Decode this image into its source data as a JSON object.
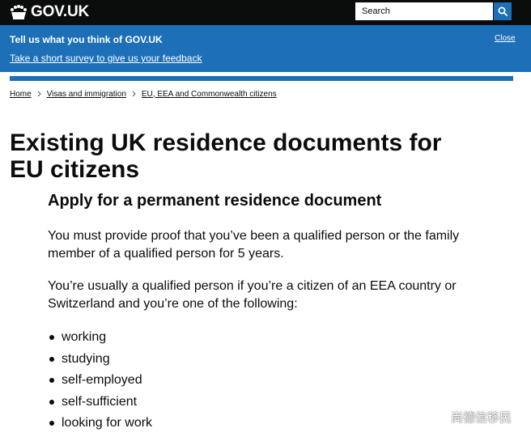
{
  "colors": {
    "header_bg": "#0b0c0c",
    "brand_blue": "#1d70b8",
    "text": "#0b0c0c",
    "white": "#ffffff"
  },
  "header": {
    "logo_text": "GOV.UK",
    "logo_icon": "crown-icon",
    "search_placeholder": "Search",
    "search_icon": "search-icon"
  },
  "survey_banner": {
    "title": "Tell us what you think of GOV.UK",
    "link": "Take a short survey to give us your feedback",
    "close": "Close"
  },
  "breadcrumb": {
    "items": [
      "Home",
      "Visas and immigration",
      "EU, EEA and Commonwealth citizens"
    ],
    "separator_icon": "chevron-right-icon"
  },
  "main": {
    "title": "Existing UK residence documents for EU citizens",
    "section_heading": "Apply for a permanent residence document",
    "paragraphs": [
      "You must provide proof that you’ve been a qualified person or the family member of a qualified person for 5 years.",
      "You’re usually a qualified person if you’re a citizen of an EEA country or Switzerland and you’re one of the following:"
    ],
    "bullets": [
      "working",
      "studying",
      "self-employed",
      "self-sufficient",
      "looking for work"
    ]
  },
  "watermark": {
    "text": "尚德信移民",
    "icon": "wechat-icon"
  }
}
